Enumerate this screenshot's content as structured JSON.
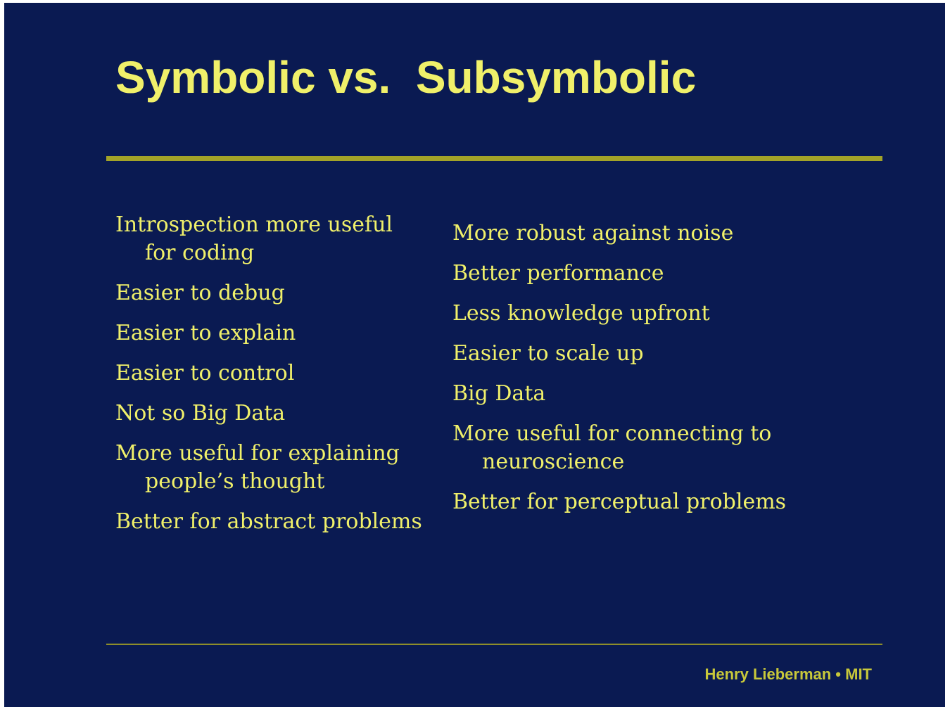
{
  "slide": {
    "title": "Symbolic vs.  Subsymbolic",
    "symbolic_points": [
      "Introspection more useful for coding",
      "Easier to debug",
      "Easier to explain",
      "Easier to control",
      "Not so Big Data",
      "More useful for explaining people’s thought",
      "Better for abstract problems"
    ],
    "subsymbolic_points": [
      "More robust against noise",
      "Better performance",
      "Less knowledge upfront",
      "Easier to scale up",
      "Big Data",
      "More useful for connecting to neuroscience",
      "Better for perceptual problems"
    ],
    "footer": "Henry Lieberman • MIT"
  },
  "colors": {
    "background": "#0a1a52",
    "text": "#f0f06a",
    "rule": "#a3a328",
    "footer": "#c8c83a"
  }
}
